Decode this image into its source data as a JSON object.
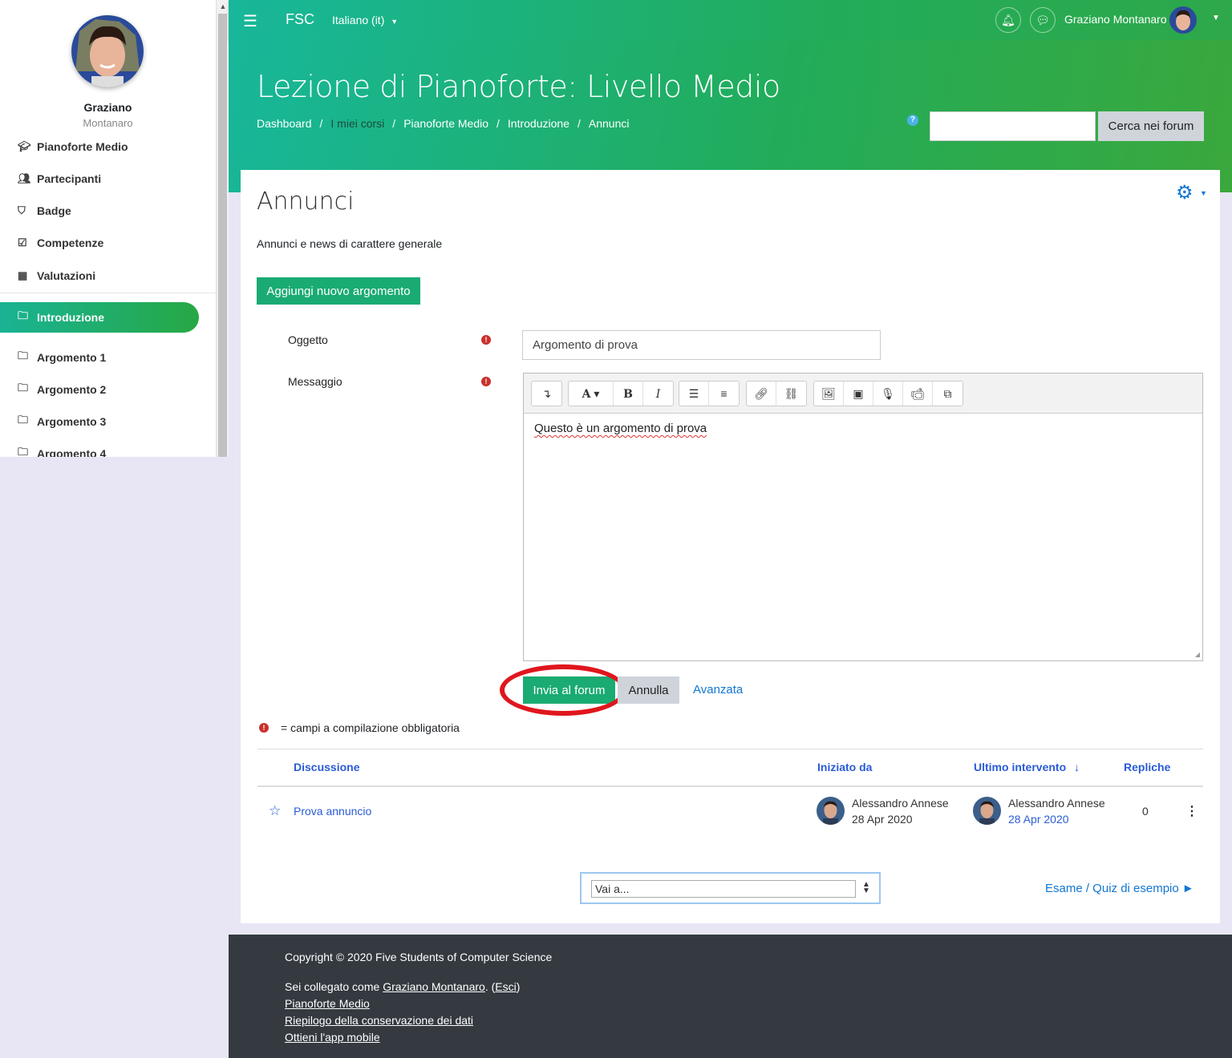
{
  "sidebar": {
    "user_first": "Graziano",
    "user_last": "Montanaro",
    "items": [
      {
        "label": "Pianoforte Medio",
        "icon": "graduation-cap-icon"
      },
      {
        "label": "Partecipanti",
        "icon": "users-icon"
      },
      {
        "label": "Badge",
        "icon": "shield-icon"
      },
      {
        "label": "Competenze",
        "icon": "check-square-icon"
      },
      {
        "label": "Valutazioni",
        "icon": "table-icon"
      }
    ],
    "sections": [
      {
        "label": "Introduzione",
        "active": true
      },
      {
        "label": "Argomento 1"
      },
      {
        "label": "Argomento 2"
      },
      {
        "label": "Argomento 3"
      },
      {
        "label": "Argomento 4"
      }
    ]
  },
  "topbar": {
    "brand": "FSC",
    "language": "Italiano ‎(it)‎",
    "username": "Graziano Montanaro"
  },
  "banner": {
    "course_title": "Lezione di Pianoforte: Livello Medio",
    "breadcrumb": [
      "Dashboard",
      "I miei corsi",
      "Pianoforte Medio",
      "Introduzione",
      "Annunci"
    ],
    "search_button": "Cerca nei forum",
    "search_value": ""
  },
  "forum": {
    "heading": "Annunci",
    "intro": "Annunci e news di carattere generale",
    "add_button": "Aggiungi nuovo argomento",
    "subject_label": "Oggetto",
    "subject_value": "Argomento di prova",
    "message_label": "Messaggio",
    "message_value": "Questo è un argomento di prova",
    "submit_button": "Invia al forum",
    "cancel_button": "Annulla",
    "advanced_link": "Avanzata",
    "required_note": "= campi a compilazione obbligatoria"
  },
  "table": {
    "headers": {
      "discussion": "Discussione",
      "started_by": "Iniziato da",
      "last_post": "Ultimo intervento",
      "replies": "Repliche"
    },
    "rows": [
      {
        "title": "Prova annuncio",
        "started_by_name": "Alessandro Annese",
        "started_by_date": "28 Apr 2020",
        "last_post_name": "Alessandro Annese",
        "last_post_date": "28 Apr 2020",
        "replies": "0"
      }
    ]
  },
  "nav": {
    "jump_placeholder": "Vai a...",
    "next_activity": "Esame / Quiz di esempio ►"
  },
  "footer": {
    "copyright": "Copyright © 2020 Five Students of Computer Science",
    "logged_in_prefix": "Sei collegato come ",
    "logged_in_user": "Graziano Montanaro",
    "logout": "Esci",
    "course_link": "Pianoforte Medio",
    "privacy_link": "Riepilogo della conservazione dei dati",
    "app_link": "Ottieni l'app mobile"
  },
  "colors": {
    "brand_green": "#1aab72",
    "header_gradient_start": "#17b79a",
    "header_gradient_end": "#2ea84a",
    "link_blue": "#1177d1",
    "footer_bg": "#343a40",
    "highlight_red": "#e0161d"
  }
}
